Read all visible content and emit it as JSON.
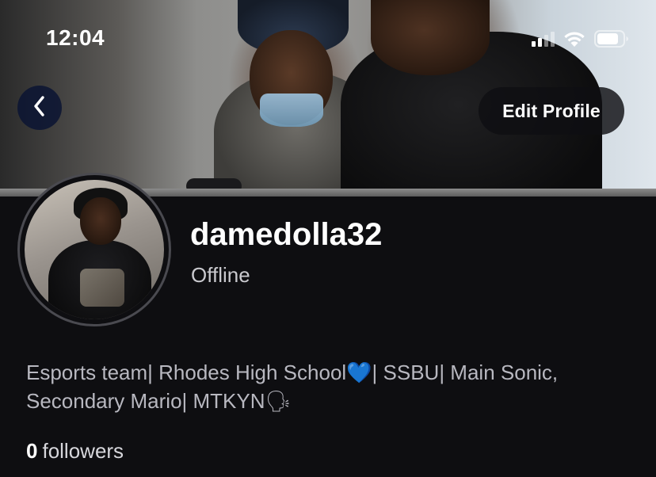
{
  "status_bar": {
    "time": "12:04",
    "icons": [
      "cellular-signal-icon",
      "wifi-icon",
      "battery-icon"
    ]
  },
  "header": {
    "back_icon": "chevron-left-icon",
    "edit_profile_label": "Edit Profile"
  },
  "profile": {
    "username": "damedolla32",
    "status": "Offline",
    "bio": "Esports team| Rhodes High School💙| SSBU| Main Sonic, Secondary Mario| MTKYN🗣",
    "followers_count": "0",
    "followers_label": "followers"
  },
  "colors": {
    "background": "#0e0e11",
    "back_button": "#0a1432",
    "text_primary": "#ffffff",
    "text_secondary": "#b8b8c0"
  }
}
